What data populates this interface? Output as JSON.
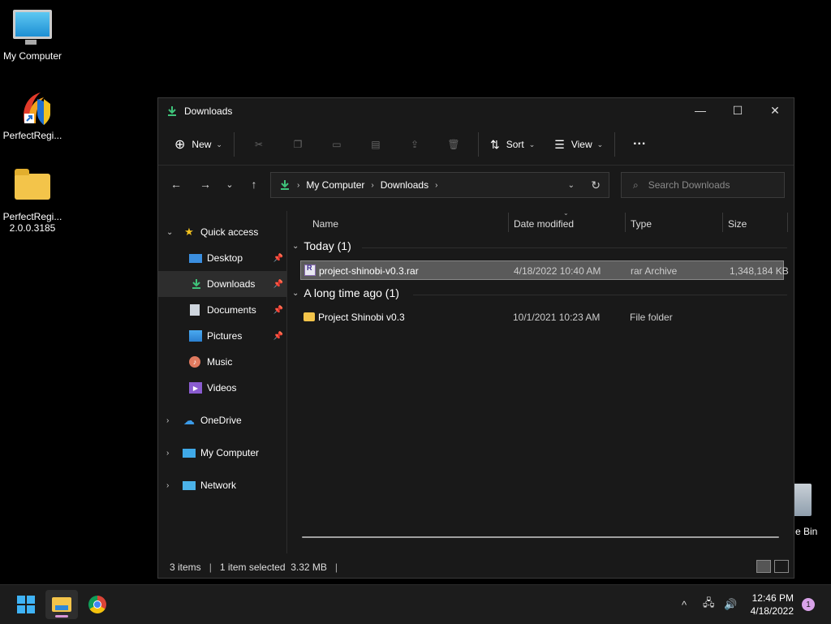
{
  "desktop": {
    "icons": [
      {
        "label": "My Computer"
      },
      {
        "label": "PerfectRegi..."
      },
      {
        "label": "PerfectRegi... 2.0.0.3185"
      }
    ],
    "recycle_bin_label": "e Bin"
  },
  "window": {
    "title": "Downloads",
    "controls": {
      "minimize": "—",
      "maximize": "☐",
      "close": "✕"
    }
  },
  "toolbar": {
    "new_label": "New",
    "sort_label": "Sort",
    "view_label": "View",
    "more_label": "···"
  },
  "address": {
    "crumbs": [
      "My Computer",
      "Downloads"
    ]
  },
  "search": {
    "placeholder": "Search Downloads"
  },
  "navpane": {
    "quick_access": "Quick access",
    "items": [
      {
        "label": "Desktop",
        "pinned": true
      },
      {
        "label": "Downloads",
        "pinned": true,
        "selected": true
      },
      {
        "label": "Documents",
        "pinned": true
      },
      {
        "label": "Pictures",
        "pinned": true
      },
      {
        "label": "Music",
        "pinned": false
      },
      {
        "label": "Videos",
        "pinned": false
      }
    ],
    "roots": [
      "OneDrive",
      "My Computer",
      "Network"
    ]
  },
  "columns": {
    "name": "Name",
    "date": "Date modified",
    "type": "Type",
    "size": "Size"
  },
  "groups": [
    {
      "header": "Today (1)",
      "files": [
        {
          "name": "project-shinobi-v0.3.rar",
          "date": "4/18/2022 10:40 AM",
          "type": "rar Archive",
          "size": "1,348,184 KB",
          "selected": true
        }
      ]
    },
    {
      "header": "A long time ago (1)",
      "files": [
        {
          "name": "Project Shinobi v0.3",
          "date": "10/1/2021 10:23 AM",
          "type": "File folder",
          "size": "",
          "selected": false
        }
      ]
    }
  ],
  "status": {
    "items": "3 items",
    "selected": "1 item selected  3.32 MB"
  },
  "taskbar": {
    "time": "12:46 PM",
    "date": "4/18/2022",
    "notifications": "1"
  },
  "colors": {
    "accent": "#3fb3f6",
    "selection": "#5a5a5a",
    "window_bg": "#191919"
  }
}
